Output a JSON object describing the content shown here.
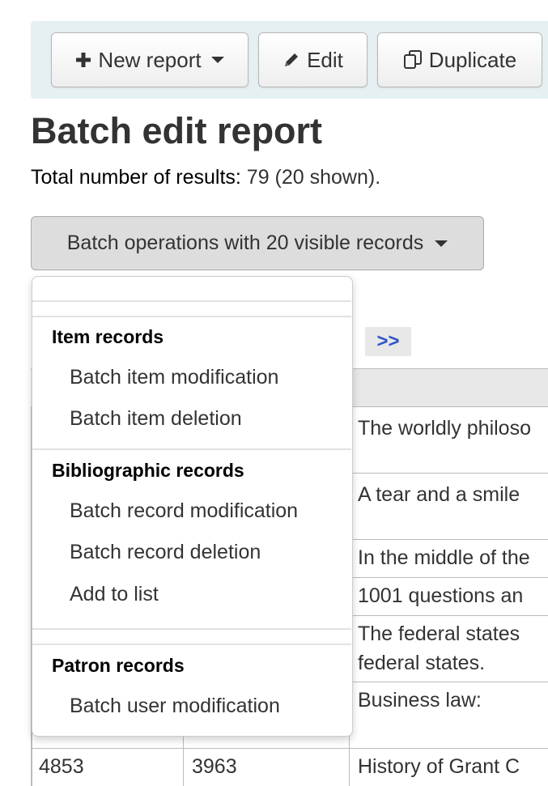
{
  "toolbar": {
    "new_report_label": "New report",
    "edit_label": "Edit",
    "duplicate_label": "Duplicate"
  },
  "page_title": "Batch edit report",
  "results": {
    "prefix": "Total number of results:",
    "count_text": "79 (20 shown)."
  },
  "batch_button_label": "Batch operations with 20 visible records",
  "pager_next_label": ">>",
  "dropdown": {
    "item_records": {
      "header": "Item records",
      "items": [
        "Batch item modification",
        "Batch item deletion"
      ]
    },
    "bibliographic_records": {
      "header": "Bibliographic records",
      "items": [
        "Batch record modification",
        "Batch record deletion",
        "Add to list"
      ]
    },
    "patron_records": {
      "header": "Patron records",
      "items": [
        "Batch user modification"
      ]
    }
  },
  "table": {
    "rows": [
      {
        "c1": "",
        "c2": "",
        "c3a": "The worldly philoso",
        "c3b": ""
      },
      {
        "c1": "",
        "c2": "",
        "c3a": "A tear and a smile",
        "c3b": ""
      },
      {
        "c1": "",
        "c2": "",
        "c3a": "In the middle of the",
        "c3b": ""
      },
      {
        "c1": "",
        "c2": "",
        "c3a": "1001 questions an",
        "c3b": ""
      },
      {
        "c1": "",
        "c2": "",
        "c3a": "The federal states",
        "c3b": "federal states."
      },
      {
        "c1": "",
        "c2": "",
        "c3a": "Business law:",
        "c3b": ""
      },
      {
        "c1": "4853",
        "c2": "3963",
        "c3a": "History of Grant C",
        "c3b": ""
      }
    ]
  }
}
